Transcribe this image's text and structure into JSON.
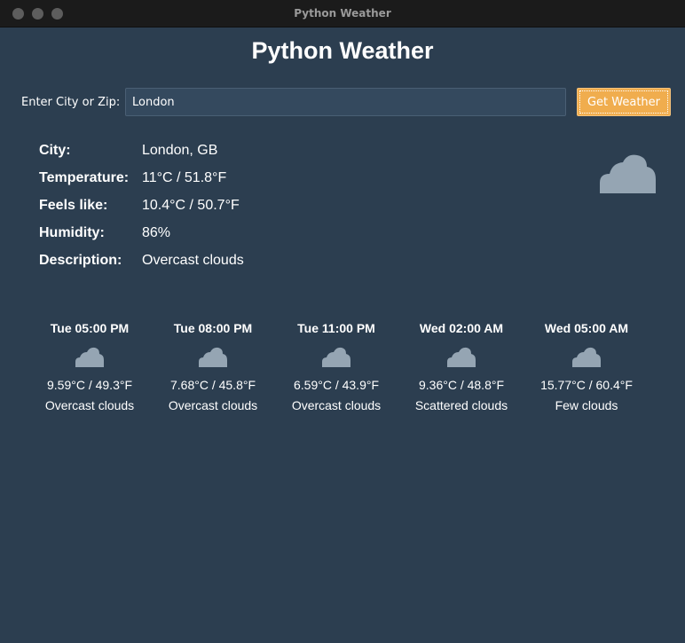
{
  "window": {
    "title": "Python Weather"
  },
  "page_title": "Python Weather",
  "search": {
    "label": "Enter City or Zip:",
    "value": "London",
    "button_label": "Get Weather"
  },
  "current": {
    "city_label": "City:",
    "city": "London, GB",
    "temperature_label": "Temperature:",
    "temperature": "11°C / 51.8°F",
    "feels_like_label": "Feels like:",
    "feels_like": "10.4°C / 50.7°F",
    "humidity_label": "Humidity:",
    "humidity": "86%",
    "description_label": "Description:",
    "description": "Overcast clouds",
    "icon": "cloud-icon"
  },
  "forecast": [
    {
      "time": "Tue 05:00 PM",
      "temp": "9.59°C / 49.3°F",
      "desc": "Overcast clouds",
      "icon": "cloud-icon"
    },
    {
      "time": "Tue 08:00 PM",
      "temp": "7.68°C / 45.8°F",
      "desc": "Overcast clouds",
      "icon": "cloud-icon"
    },
    {
      "time": "Tue 11:00 PM",
      "temp": "6.59°C / 43.9°F",
      "desc": "Overcast clouds",
      "icon": "cloud-icon"
    },
    {
      "time": "Wed 02:00 AM",
      "temp": "9.36°C / 48.8°F",
      "desc": "Scattered clouds",
      "icon": "cloud-icon"
    },
    {
      "time": "Wed 05:00 AM",
      "temp": "15.77°C / 60.4°F",
      "desc": "Few clouds",
      "icon": "cloud-icon"
    }
  ],
  "colors": {
    "background": "#2c3e50",
    "input_background": "#34495e",
    "accent": "#f0ad4e",
    "icon": "#95a5b3",
    "text": "#ffffff"
  }
}
